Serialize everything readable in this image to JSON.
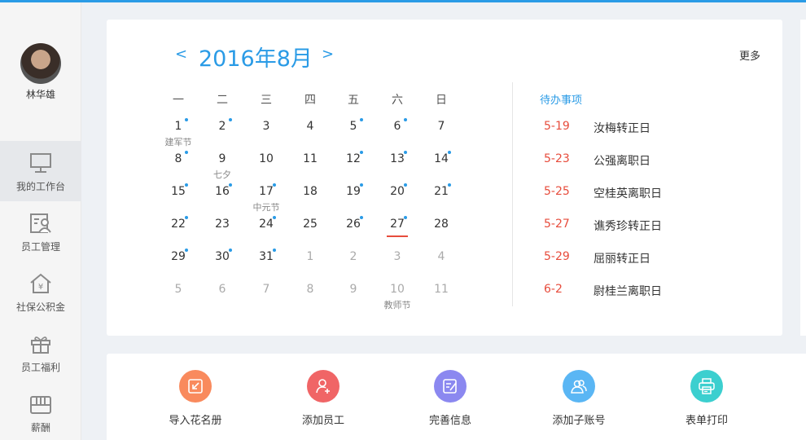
{
  "user": {
    "name": "林华雄"
  },
  "sidebar": {
    "items": [
      {
        "label": "我的工作台",
        "icon": "monitor-icon",
        "active": true
      },
      {
        "label": "员工管理",
        "icon": "employee-card-icon"
      },
      {
        "label": "社保公积金",
        "icon": "house-yen-icon"
      },
      {
        "label": "员工福利",
        "icon": "gift-icon"
      },
      {
        "label": "薪酬",
        "icon": "wallet-icon"
      }
    ]
  },
  "calendar": {
    "prev_label": "<",
    "next_label": ">",
    "title": "2016年8月",
    "more_label": "更多",
    "weekdays": [
      "一",
      "二",
      "三",
      "四",
      "五",
      "六",
      "日"
    ],
    "weeks": [
      [
        {
          "d": "1",
          "dot": true,
          "note": "建军节"
        },
        {
          "d": "2",
          "dot": true
        },
        {
          "d": "3"
        },
        {
          "d": "4"
        },
        {
          "d": "5",
          "dot": true
        },
        {
          "d": "6",
          "dot": true
        },
        {
          "d": "7"
        }
      ],
      [
        {
          "d": "8",
          "dot": true
        },
        {
          "d": "9",
          "note": "七夕"
        },
        {
          "d": "10"
        },
        {
          "d": "11"
        },
        {
          "d": "12",
          "dot": true
        },
        {
          "d": "13",
          "dot": true
        },
        {
          "d": "14",
          "dot": true
        }
      ],
      [
        {
          "d": "15",
          "dot": true
        },
        {
          "d": "16",
          "dot": true
        },
        {
          "d": "17",
          "dot": true,
          "note": "中元节"
        },
        {
          "d": "18"
        },
        {
          "d": "19",
          "dot": true
        },
        {
          "d": "20",
          "dot": true
        },
        {
          "d": "21",
          "dot": true
        }
      ],
      [
        {
          "d": "22",
          "dot": true
        },
        {
          "d": "23"
        },
        {
          "d": "24",
          "dot": true
        },
        {
          "d": "25"
        },
        {
          "d": "26",
          "dot": true
        },
        {
          "d": "27",
          "dot": true,
          "today": true
        },
        {
          "d": "28"
        }
      ],
      [
        {
          "d": "29",
          "dot": true
        },
        {
          "d": "30",
          "dot": true
        },
        {
          "d": "31",
          "dot": true
        },
        {
          "d": "1",
          "dim": true
        },
        {
          "d": "2",
          "dim": true
        },
        {
          "d": "3",
          "dim": true
        },
        {
          "d": "4",
          "dim": true
        }
      ],
      [
        {
          "d": "5",
          "dim": true
        },
        {
          "d": "6",
          "dim": true
        },
        {
          "d": "7",
          "dim": true
        },
        {
          "d": "8",
          "dim": true
        },
        {
          "d": "9",
          "dim": true
        },
        {
          "d": "10",
          "dim": true,
          "note": "教师节"
        },
        {
          "d": "11",
          "dim": true
        }
      ]
    ]
  },
  "todo": {
    "title": "待办事项",
    "items": [
      {
        "date": "5-19",
        "text": "汝梅转正日"
      },
      {
        "date": "5-23",
        "text": "公强离职日"
      },
      {
        "date": "5-25",
        "text": "空桂英离职日"
      },
      {
        "date": "5-27",
        "text": "谯秀珍转正日"
      },
      {
        "date": "5-29",
        "text": "屈丽转正日"
      },
      {
        "date": "6-2",
        "text": "尉桂兰离职日"
      }
    ]
  },
  "actions": [
    {
      "label": "导入花名册",
      "icon": "import-icon",
      "color": "#f98a5d"
    },
    {
      "label": "添加员工",
      "icon": "add-user-icon",
      "color": "#f06566"
    },
    {
      "label": "完善信息",
      "icon": "edit-info-icon",
      "color": "#8b88f0"
    },
    {
      "label": "添加子账号",
      "icon": "sub-account-icon",
      "color": "#5ab6f4"
    },
    {
      "label": "表单打印",
      "icon": "printer-icon",
      "color": "#3ccfcf"
    }
  ],
  "colors": {
    "accent": "#2a9be6",
    "todo_date": "#e74c3c"
  }
}
